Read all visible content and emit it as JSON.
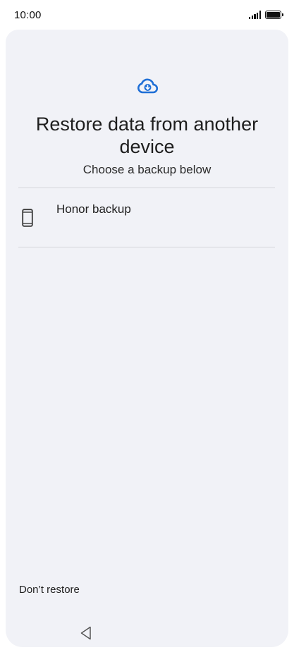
{
  "status_bar": {
    "time": "10:00",
    "icons": [
      "signal-icon",
      "battery-icon"
    ]
  },
  "screen": {
    "header_icon": "cloud-download-icon",
    "title": "Restore data from another device",
    "subtitle": "Choose a backup below",
    "backups": [
      {
        "label": "Honor backup",
        "icon": "phone-icon"
      }
    ],
    "dont_restore_label": "Don’t restore"
  },
  "navigation_bar": {
    "icons": [
      "back-triangle-icon"
    ]
  },
  "colors": {
    "accent": "#1f6fd6",
    "sheet_background": "#f1f2f7",
    "divider": "#d4d5da"
  }
}
